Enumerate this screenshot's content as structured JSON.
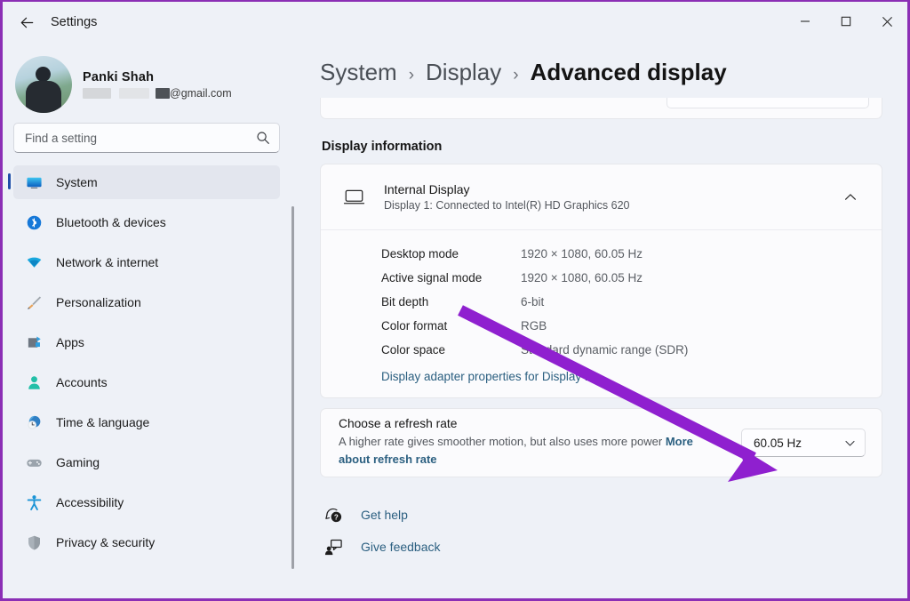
{
  "window": {
    "app_title": "Settings",
    "back_icon": "back-arrow-icon",
    "minimize_label": "─",
    "maximize_label": "□",
    "close_label": "✕",
    "border_color": "#8b2fb5"
  },
  "account": {
    "name": "Panki Shah",
    "email_domain": "@gmail.com",
    "email_redacted": true
  },
  "search": {
    "placeholder": "Find a setting",
    "value": "",
    "icon": "search-icon"
  },
  "sidebar": {
    "items": [
      {
        "label": "System",
        "icon": "system-icon",
        "active": true
      },
      {
        "label": "Bluetooth & devices",
        "icon": "bluetooth-icon",
        "active": false
      },
      {
        "label": "Network & internet",
        "icon": "network-icon",
        "active": false
      },
      {
        "label": "Personalization",
        "icon": "paintbrush-icon",
        "active": false
      },
      {
        "label": "Apps",
        "icon": "apps-icon",
        "active": false
      },
      {
        "label": "Accounts",
        "icon": "accounts-icon",
        "active": false
      },
      {
        "label": "Time & language",
        "icon": "clock-icon",
        "active": false
      },
      {
        "label": "Gaming",
        "icon": "gamepad-icon",
        "active": false
      },
      {
        "label": "Accessibility",
        "icon": "accessibility-icon",
        "active": false
      },
      {
        "label": "Privacy & security",
        "icon": "shield-icon",
        "active": false
      }
    ]
  },
  "breadcrumb": {
    "root": "System",
    "parent": "Display",
    "current": "Advanced display",
    "separator": "›"
  },
  "main": {
    "section_title": "Display information",
    "display": {
      "icon": "monitor-icon",
      "name": "Internal Display",
      "subtitle": "Display 1: Connected to Intel(R) HD Graphics 620",
      "expanded": true,
      "collapse_icon": "chevron-up-icon",
      "details": [
        {
          "key": "Desktop mode",
          "value": "1920 × 1080, 60.05 Hz"
        },
        {
          "key": "Active signal mode",
          "value": "1920 × 1080, 60.05 Hz"
        },
        {
          "key": "Bit depth",
          "value": "6-bit"
        },
        {
          "key": "Color format",
          "value": "RGB"
        },
        {
          "key": "Color space",
          "value": "Standard dynamic range (SDR)"
        }
      ],
      "adapter_link": "Display adapter properties for Display 1"
    },
    "refresh_rate": {
      "title": "Choose a refresh rate",
      "description": "A higher rate gives smoother motion, but also uses more power",
      "link_text": "More about refresh rate",
      "selected": "60.05 Hz",
      "chevron_icon": "chevron-down-icon"
    }
  },
  "footer": {
    "links": [
      {
        "label": "Get help",
        "icon": "help-icon"
      },
      {
        "label": "Give feedback",
        "icon": "feedback-icon"
      }
    ]
  },
  "annotation": {
    "type": "arrow",
    "color": "#8f20cf",
    "points_to": "refresh-rate-dropdown"
  }
}
